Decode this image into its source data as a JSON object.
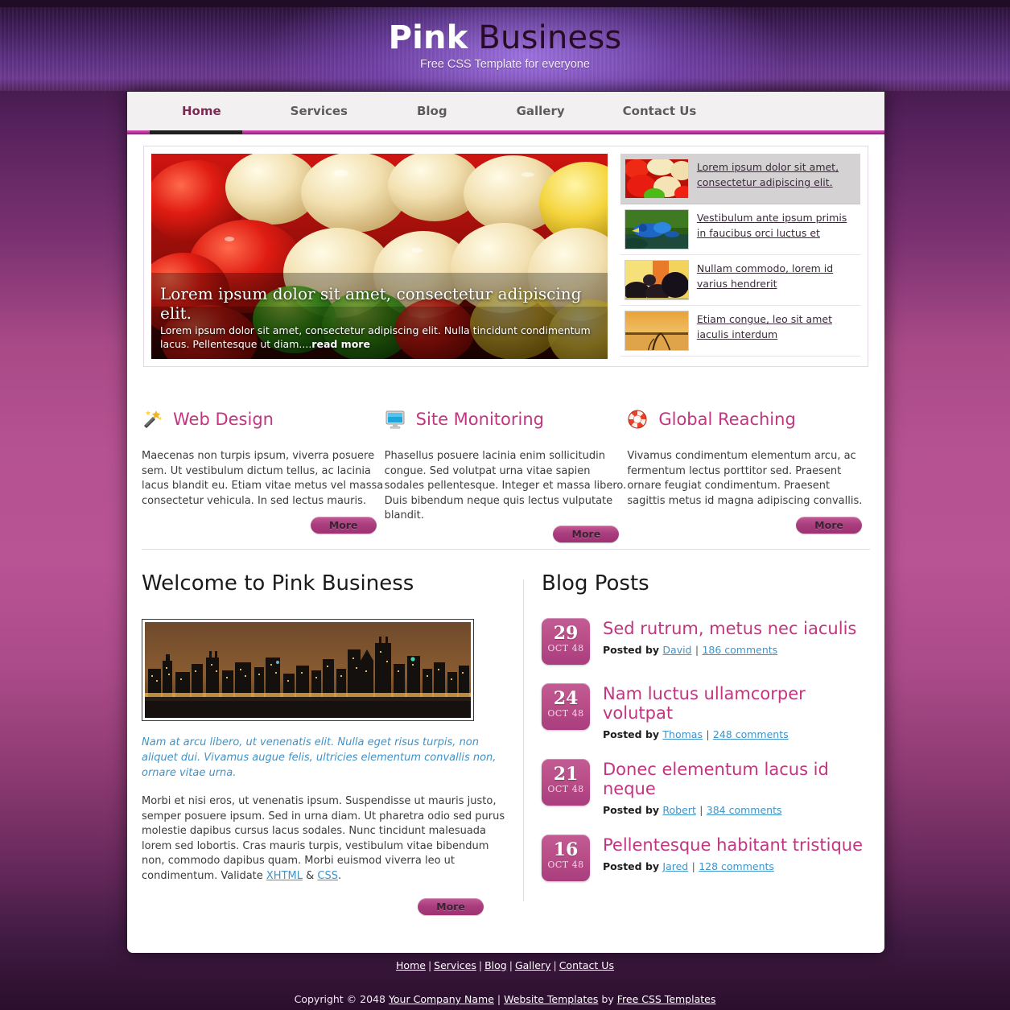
{
  "header": {
    "logo_strong": "Pink",
    "logo_rest": " Business",
    "tagline": "Free CSS Template for everyone"
  },
  "menu": {
    "items": [
      {
        "label": "Home",
        "active": true
      },
      {
        "label": "Services",
        "active": false
      },
      {
        "label": "Blog",
        "active": false
      },
      {
        "label": "Gallery",
        "active": false
      },
      {
        "label": "Contact Us",
        "active": false
      }
    ]
  },
  "banner": {
    "caption_title": "Lorem ipsum dolor sit amet, consectetur adipiscing elit.",
    "caption_text": "Lorem ipsum dolor sit amet, consectetur adipiscing elit. Nulla tincidunt condimentum lacus. Pellentesque ut diam....",
    "caption_readmore": "read more",
    "list": [
      {
        "text": "Lorem ipsum dolor sit amet, consectetur adipiscing elit.",
        "thumb": "peppers-thumb",
        "selected": true
      },
      {
        "text": "Vestibulum ante ipsum primis in faucibus orci luctus et",
        "thumb": "parrot-thumb",
        "selected": false
      },
      {
        "text": "Nullam commodo, lorem id varius hendrerit",
        "thumb": "blackberry-thumb",
        "selected": false
      },
      {
        "text": "Etiam congue, leo sit amet iaculis interdum",
        "thumb": "sunset-thumb",
        "selected": false
      }
    ]
  },
  "columns": [
    {
      "icon": "magic-wand-icon",
      "title": "Web Design",
      "text": "Maecenas non turpis ipsum, viverra posuere sem. Ut vestibulum dictum tellus, ac lacinia lacus blandit eu. Etiam vitae metus vel massa consectetur vehicula. In sed lectus mauris.",
      "more": "More"
    },
    {
      "icon": "monitor-icon",
      "title": "Site Monitoring",
      "text": "Phasellus posuere lacinia enim sollicitudin congue. Sed volutpat urna vitae sapien sodales pellentesque. Integer et massa libero. Duis bibendum neque quis lectus vulputate blandit.",
      "more": "More"
    },
    {
      "icon": "lifebuoy-icon",
      "title": "Global Reaching",
      "text": "Vivamus condimentum elementum arcu, ac fermentum lectus porttitor sed. Praesent ornare feugiat condimentum. Praesent sagittis metus id magna adipiscing convallis.",
      "more": "More"
    }
  ],
  "welcome": {
    "title": "Welcome to Pink Business",
    "image": "city-skyline-night",
    "lead": "Nam at arcu libero, ut venenatis elit. Nulla eget risus turpis, non aliquet dui. Vivamus augue felis, ultricies elementum convallis non, ornare vitae urna.",
    "body_before": "Morbi et nisi eros, ut venenatis ipsum. Suspendisse ut mauris justo, semper posuere ipsum. Sed in urna diam. Ut pharetra odio sed purus molestie dapibus cursus lacus sodales. Nunc tincidunt malesuada lorem sed lobortis. Cras mauris turpis, vestibulum vitae bibendum non, commodo dapibus quam. Morbi euismod viverra leo ut condimentum. Validate ",
    "link_xhtml": "XHTML",
    "body_amp": " & ",
    "link_css": "CSS",
    "body_end": ".",
    "more": "More"
  },
  "blog": {
    "title": "Blog Posts",
    "posted_by": "Posted by",
    "separator": "|",
    "posts": [
      {
        "day": "29",
        "month": "OCT 48",
        "title": "Sed rutrum, metus nec iaculis",
        "author": "David",
        "comments": "186 comments"
      },
      {
        "day": "24",
        "month": "OCT 48",
        "title": "Nam luctus ullamcorper volutpat",
        "author": "Thomas",
        "comments": "248 comments"
      },
      {
        "day": "21",
        "month": "OCT 48",
        "title": "Donec elementum lacus id neque",
        "author": "Robert",
        "comments": "384 comments"
      },
      {
        "day": "16",
        "month": "OCT 48",
        "title": "Pellentesque habitant tristique",
        "author": "Jared",
        "comments": "128 comments"
      }
    ]
  },
  "footer": {
    "nav": [
      "Home",
      "Services",
      "Blog",
      "Gallery",
      "Contact Us"
    ],
    "copyright_prefix": "Copyright © 2048 ",
    "company": "Your Company Name",
    "mid": " | ",
    "templates_link": "Website Templates",
    "by": " by ",
    "credit_link": "Free CSS Templates"
  },
  "colors": {
    "accent_pink": "#c2357f",
    "button_pink": "#a93d7e",
    "link_blue": "#3f93c8",
    "menu_active": "#7a2a52",
    "bg_dark": "#2b0f2d",
    "bg_mid": "#b85394"
  }
}
